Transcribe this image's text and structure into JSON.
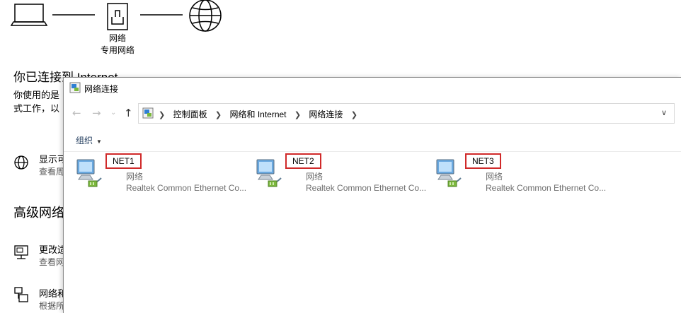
{
  "settings": {
    "diagram": {
      "network_label": "网络",
      "network_sublabel": "专用网络"
    },
    "status_heading": "你已连接到 Internet",
    "status_desc_line1": "你使用的是",
    "status_desc_line2": "式工作，以",
    "rows": [
      {
        "title": "显示可",
        "subtitle": "查看周",
        "icon": "globe-icon"
      }
    ],
    "advanced_heading": "高级网络",
    "advanced_rows": [
      {
        "title": "更改适",
        "subtitle": "查看网",
        "icon": "monitor-network-icon"
      },
      {
        "title": "网络和",
        "subtitle": "根据所",
        "icon": "network-share-icon"
      }
    ]
  },
  "window": {
    "title": "网络连接",
    "breadcrumbs": [
      "控制面板",
      "网络和 Internet",
      "网络连接"
    ],
    "toolbar": {
      "organize_label": "组织"
    },
    "connections": [
      {
        "name": "NET1",
        "status": "网络",
        "device": "Realtek Common Ethernet Co..."
      },
      {
        "name": "NET2",
        "status": "网络",
        "device": "Realtek Common Ethernet Co..."
      },
      {
        "name": "NET3",
        "status": "网络",
        "device": "Realtek Common Ethernet Co..."
      }
    ]
  },
  "colors": {
    "highlight_border": "#d02a2a",
    "organize_text": "#1e395b"
  }
}
